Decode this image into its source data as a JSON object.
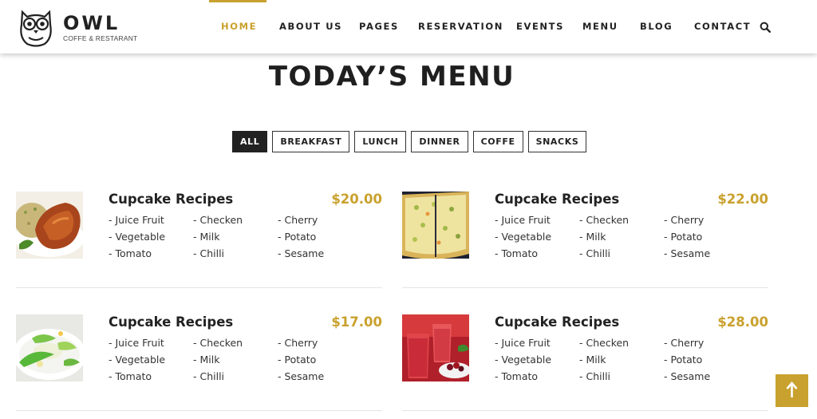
{
  "header": {
    "logo_name": "OWL",
    "logo_tagline": "COFFE & RESTARANT",
    "nav": [
      {
        "label": "HOME",
        "active": true
      },
      {
        "label": "ABOUT US",
        "active": false
      },
      {
        "label": "PAGES",
        "active": false
      },
      {
        "label": "RESERVATION",
        "active": false
      },
      {
        "label": "EVENTS",
        "active": false
      },
      {
        "label": "MENU",
        "active": false
      },
      {
        "label": "BLOG",
        "active": false
      },
      {
        "label": "CONTACT",
        "active": false
      }
    ],
    "search_icon": "search-icon"
  },
  "title": "TODAY’S MENU",
  "filters": [
    {
      "label": "ALL",
      "active": true
    },
    {
      "label": "BREAKFAST",
      "active": false
    },
    {
      "label": "LUNCH",
      "active": false
    },
    {
      "label": "DINNER",
      "active": false
    },
    {
      "label": "COFFE",
      "active": false
    },
    {
      "label": "SNACKS",
      "active": false
    }
  ],
  "menu": [
    {
      "name": "Cupcake Recipes",
      "price": "$20.00",
      "image": "roast-chicken-with-rice",
      "ingredients": [
        "- Juice Fruit",
        "- Checken",
        "- Cherry",
        "- Vegetable",
        "- Milk",
        "- Potato",
        "- Tomato",
        "- Chilli",
        "- Sesame"
      ]
    },
    {
      "name": "Cupcake Recipes",
      "price": "$22.00",
      "image": "pizza",
      "ingredients": [
        "- Juice Fruit",
        "- Checken",
        "- Cherry",
        "- Vegetable",
        "- Milk",
        "- Potato",
        "- Tomato",
        "- Chilli",
        "- Sesame"
      ]
    },
    {
      "name": "Cupcake Recipes",
      "price": "$17.00",
      "image": "vegetable-rolls",
      "ingredients": [
        "- Juice Fruit",
        "- Checken",
        "- Cherry",
        "- Vegetable",
        "- Milk",
        "- Potato",
        "- Tomato",
        "- Chilli",
        "- Sesame"
      ]
    },
    {
      "name": "Cupcake Recipes",
      "price": "$28.00",
      "image": "berry-juice-drinks",
      "ingredients": [
        "- Juice Fruit",
        "- Checken",
        "- Cherry",
        "- Vegetable",
        "- Milk",
        "- Potato",
        "- Tomato",
        "- Chilli",
        "- Sesame"
      ]
    }
  ],
  "back_to_top_icon": "arrow-up-icon",
  "colors": {
    "accent": "#c9a12e",
    "text": "#222222",
    "filter_active_bg": "#222222"
  }
}
